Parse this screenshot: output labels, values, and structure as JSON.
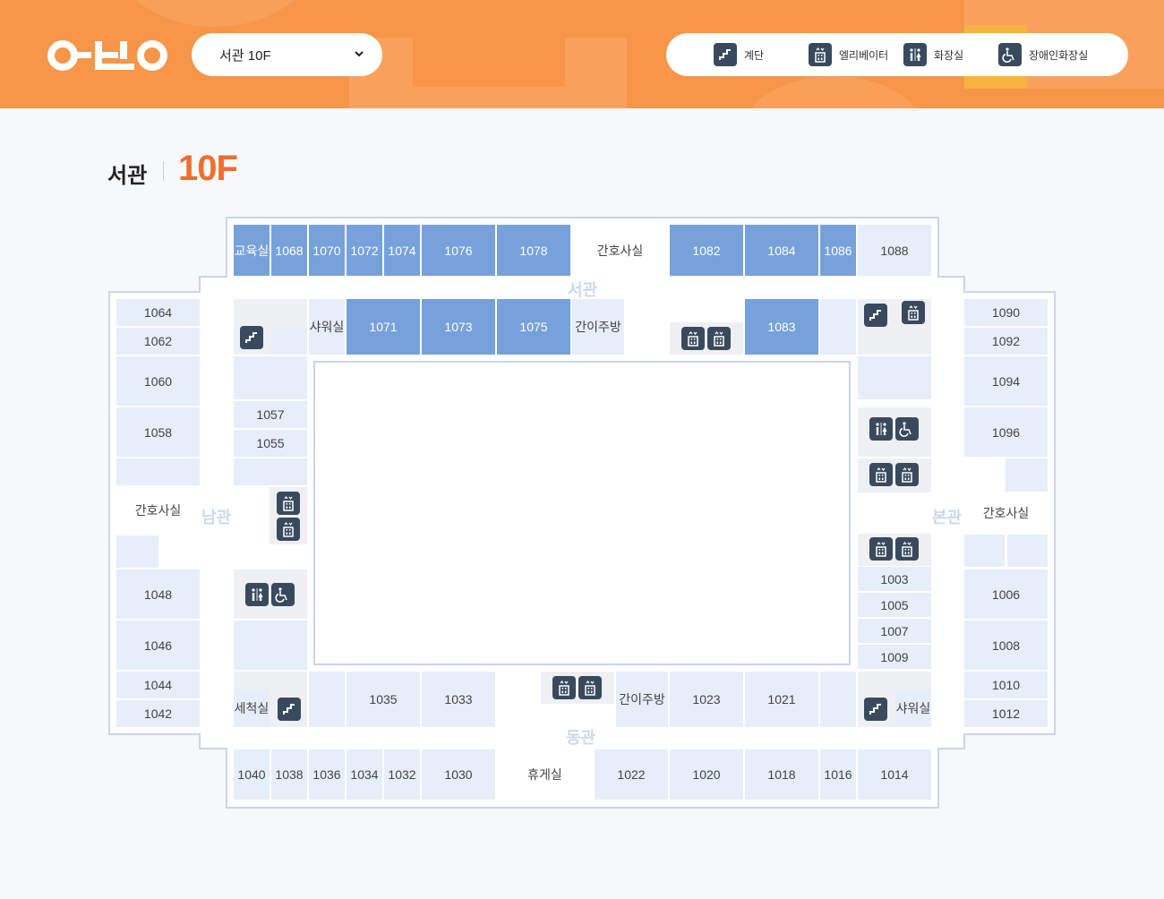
{
  "header": {
    "logo_text": "아산",
    "floor_select": {
      "value": "서관 10F"
    },
    "legend": [
      {
        "icon": "stairs-icon",
        "label": "계단"
      },
      {
        "icon": "elevator-icon",
        "label": "엘리베이터"
      },
      {
        "icon": "restroom-icon",
        "label": "화장실"
      },
      {
        "icon": "accessible-restroom-icon",
        "label": "장애인화장실"
      }
    ],
    "colors": {
      "header_bg": "#f79549",
      "accent": "#ee6d2f",
      "room_dark": "#77a1da",
      "room_light": "#e6eef9",
      "icon_bg": "#3a4a5e"
    }
  },
  "title": {
    "wing": "서관",
    "floor": "10F"
  },
  "wings": {
    "west": "서관",
    "south": "남관",
    "main": "본관",
    "east": "동관"
  },
  "rooms": {
    "r_edu": "교육실",
    "r1068": "1068",
    "r1070": "1070",
    "r1072": "1072",
    "r1074": "1074",
    "r1076": "1076",
    "r1078": "1078",
    "nurse_top": "간호사실",
    "r1082": "1082",
    "r1084": "1084",
    "r1086": "1086",
    "r1088": "1088",
    "shower_top": "샤워실",
    "r1071": "1071",
    "r1073": "1073",
    "r1075": "1075",
    "kitchen_top": "간이주방",
    "r1083": "1083",
    "r1064": "1064",
    "r1062": "1062",
    "r1060": "1060",
    "r1058": "1058",
    "nurse_left": "간호사실",
    "r1048": "1048",
    "r1046": "1046",
    "r1044": "1044",
    "r1042": "1042",
    "r1057": "1057",
    "r1055": "1055",
    "r1090": "1090",
    "r1092": "1092",
    "r1094": "1094",
    "r1096": "1096",
    "nurse_right": "간호사실",
    "r1006": "1006",
    "r1008": "1008",
    "r1010": "1010",
    "r1012": "1012",
    "r1003": "1003",
    "r1005": "1005",
    "r1007": "1007",
    "r1009": "1009",
    "wash": "세척실",
    "r1035": "1035",
    "r1033": "1033",
    "kitchen_bottom": "간이주방",
    "r1023": "1023",
    "r1021": "1021",
    "shower_bottom": "샤워실",
    "r1040": "1040",
    "r1038": "1038",
    "r1036": "1036",
    "r1034": "1034",
    "r1032": "1032",
    "r1030": "1030",
    "lounge": "휴게실",
    "r1022": "1022",
    "r1020": "1020",
    "r1018": "1018",
    "r1016": "1016",
    "r1014": "1014"
  }
}
